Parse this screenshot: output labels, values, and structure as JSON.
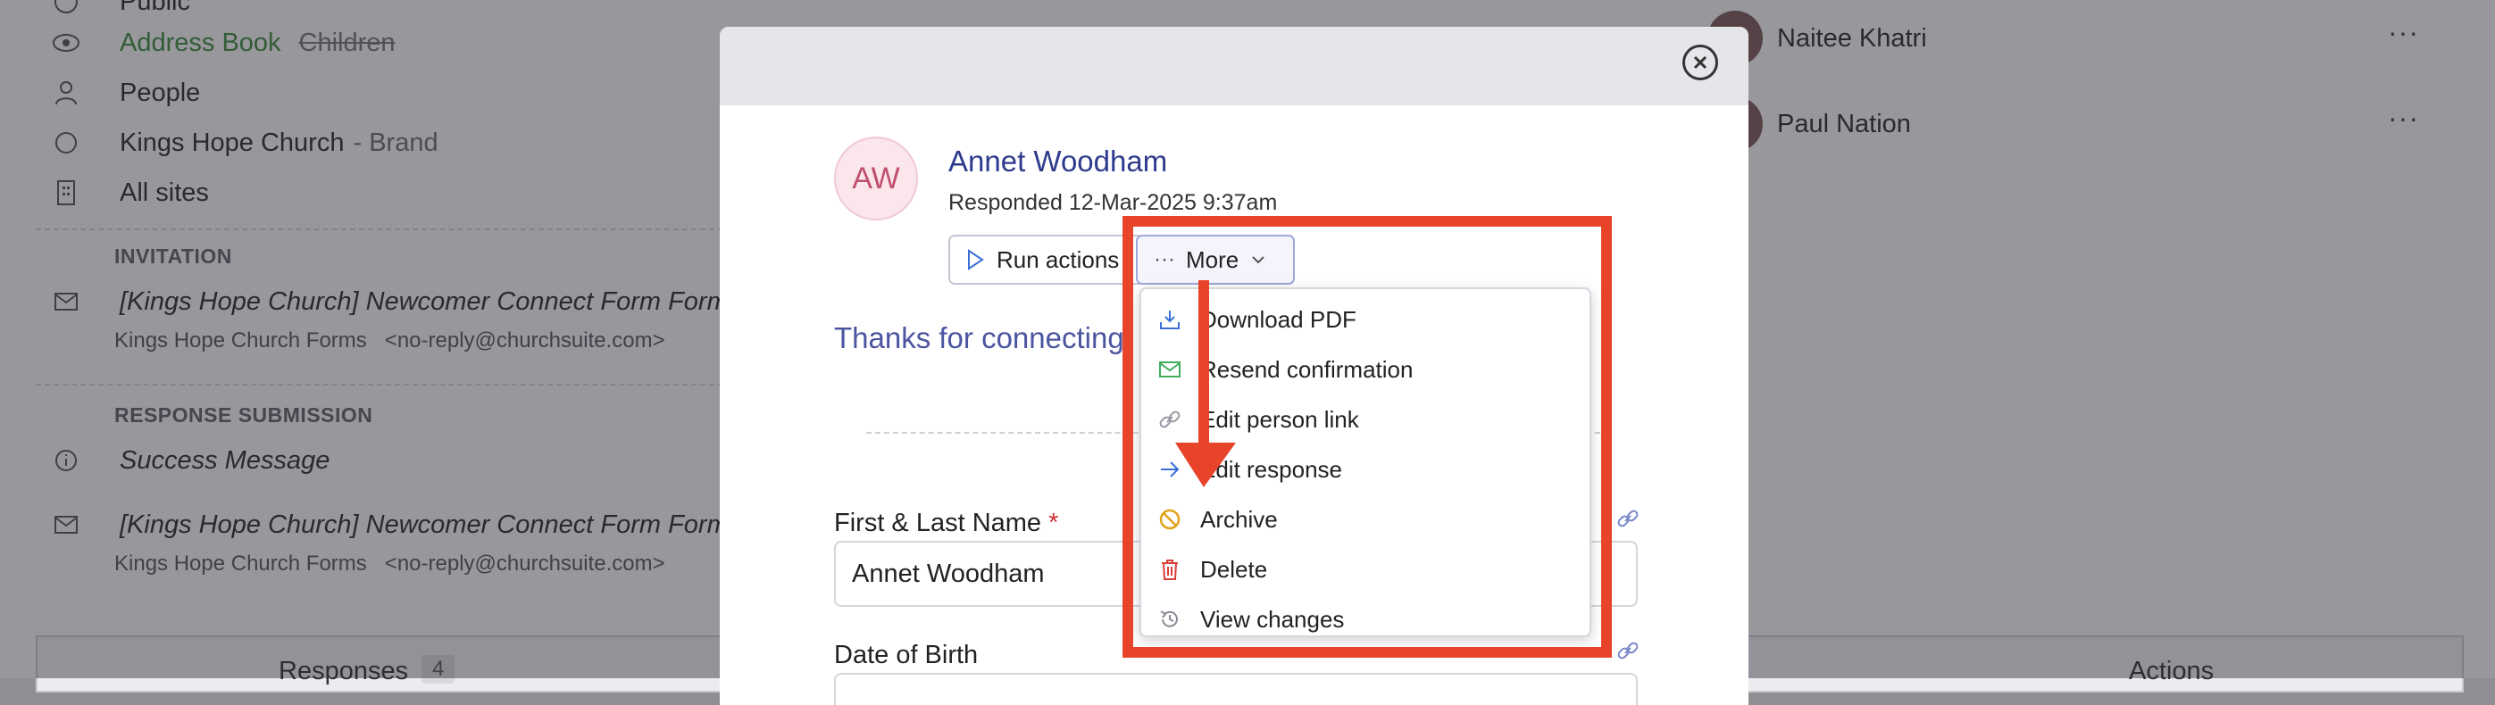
{
  "background": {
    "items": [
      {
        "label": "Public",
        "icon": "globe-icon"
      },
      {
        "label": "Address Book",
        "extra": "Children",
        "icon": "eye-icon"
      },
      {
        "label": "People",
        "icon": "person-icon"
      },
      {
        "label": "Kings Hope Church",
        "suffix": "- Brand",
        "icon": "circle-icon"
      },
      {
        "label": "All sites",
        "icon": "building-icon"
      }
    ],
    "invitation_heading": "INVITATION",
    "invitation_subject": "[Kings Hope Church] Newcomer Connect Form Form Inv",
    "invitation_from": "Kings Hope Church Forms",
    "invitation_email": "<no-reply@churchsuite.com>",
    "response_heading": "RESPONSE SUBMISSION",
    "success_message": "Success Message",
    "response_subject": "[Kings Hope Church] Newcomer Connect Form Form",
    "response_from": "Kings Hope Church Forms",
    "response_email": "<no-reply@churchsuite.com>",
    "people": [
      "Naitee Khatri",
      "Paul Nation"
    ],
    "tabs": {
      "responses": "Responses",
      "responses_count": "4",
      "actions": "Actions"
    },
    "more_glyph": "···"
  },
  "modal": {
    "initials": "AW",
    "name": "Annet Woodham",
    "responded": "Responded 12-Mar-2025 9:37am",
    "run_actions": "Run actions",
    "more": "More",
    "thanks": "Thanks for connecting",
    "fields": [
      {
        "label": "First & Last Name",
        "required": "*",
        "value": "Annet Woodham"
      },
      {
        "label": "Date of Birth"
      }
    ]
  },
  "menu": {
    "items": [
      {
        "label": "Download PDF",
        "icon": "download-icon",
        "color": "#3a6fd8"
      },
      {
        "label": "Resend confirmation",
        "icon": "envelope-icon",
        "color": "#3fae5b"
      },
      {
        "label": "Edit person link",
        "icon": "link-icon",
        "color": "#9a9aa4"
      },
      {
        "label": "Edit response",
        "icon": "arrow-right-icon",
        "color": "#3a6fd8"
      },
      {
        "label": "Archive",
        "icon": "ban-icon",
        "color": "#e3a21a"
      },
      {
        "label": "Delete",
        "icon": "trash-icon",
        "color": "#d8403a"
      },
      {
        "label": "View changes",
        "icon": "history-icon",
        "color": "#8a8a94"
      }
    ]
  },
  "colors": {
    "annotation": "#e8442a",
    "accent": "#2e3a8c"
  }
}
